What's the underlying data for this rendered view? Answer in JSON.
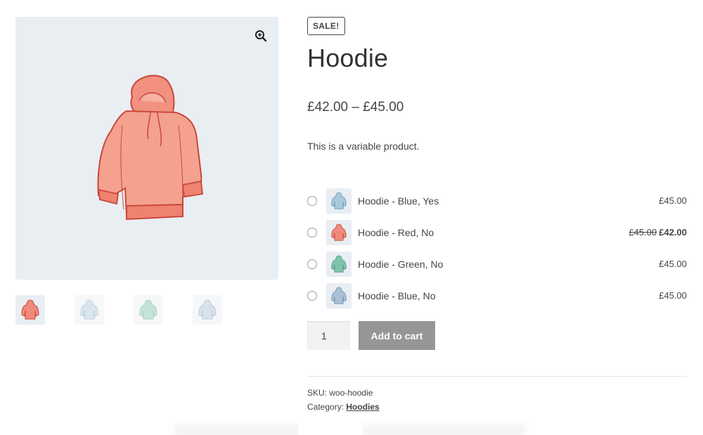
{
  "product": {
    "sale_badge": "SALE!",
    "title": "Hoodie",
    "price_range": "£42.00 – £45.00",
    "description": "This is a variable product."
  },
  "gallery": {
    "zoom_icon": "magnifier-plus-icon",
    "thumbnails": [
      {
        "color": "#ef8a7a",
        "icon": "hoodie-red-icon"
      },
      {
        "color": "#a9c9dd",
        "icon": "hoodie-blue-icon"
      },
      {
        "color": "#7fc3ad",
        "icon": "hoodie-green-icon"
      },
      {
        "color": "#a9c1d6",
        "icon": "hoodie-blue-icon"
      }
    ]
  },
  "variations": [
    {
      "name": "Hoodie - Blue, Yes",
      "price": "£45.00",
      "old_price": "",
      "color": "#a9c9dd"
    },
    {
      "name": "Hoodie - Red, No",
      "price": "£42.00",
      "old_price": "£45.00",
      "color": "#ef8a7a"
    },
    {
      "name": "Hoodie - Green, No",
      "price": "£45.00",
      "old_price": "",
      "color": "#7fc3ad"
    },
    {
      "name": "Hoodie - Blue, No",
      "price": "£45.00",
      "old_price": "",
      "color": "#a9c1d6"
    }
  ],
  "cart": {
    "quantity": "1",
    "add_to_cart_label": "Add to cart"
  },
  "meta": {
    "sku_label": "SKU:",
    "sku": "woo-hoodie",
    "category_label": "Category:",
    "category": "Hoodies"
  },
  "colors": {
    "button": "#969696",
    "text": "#43454b",
    "image_bg": "#e9eef3"
  }
}
